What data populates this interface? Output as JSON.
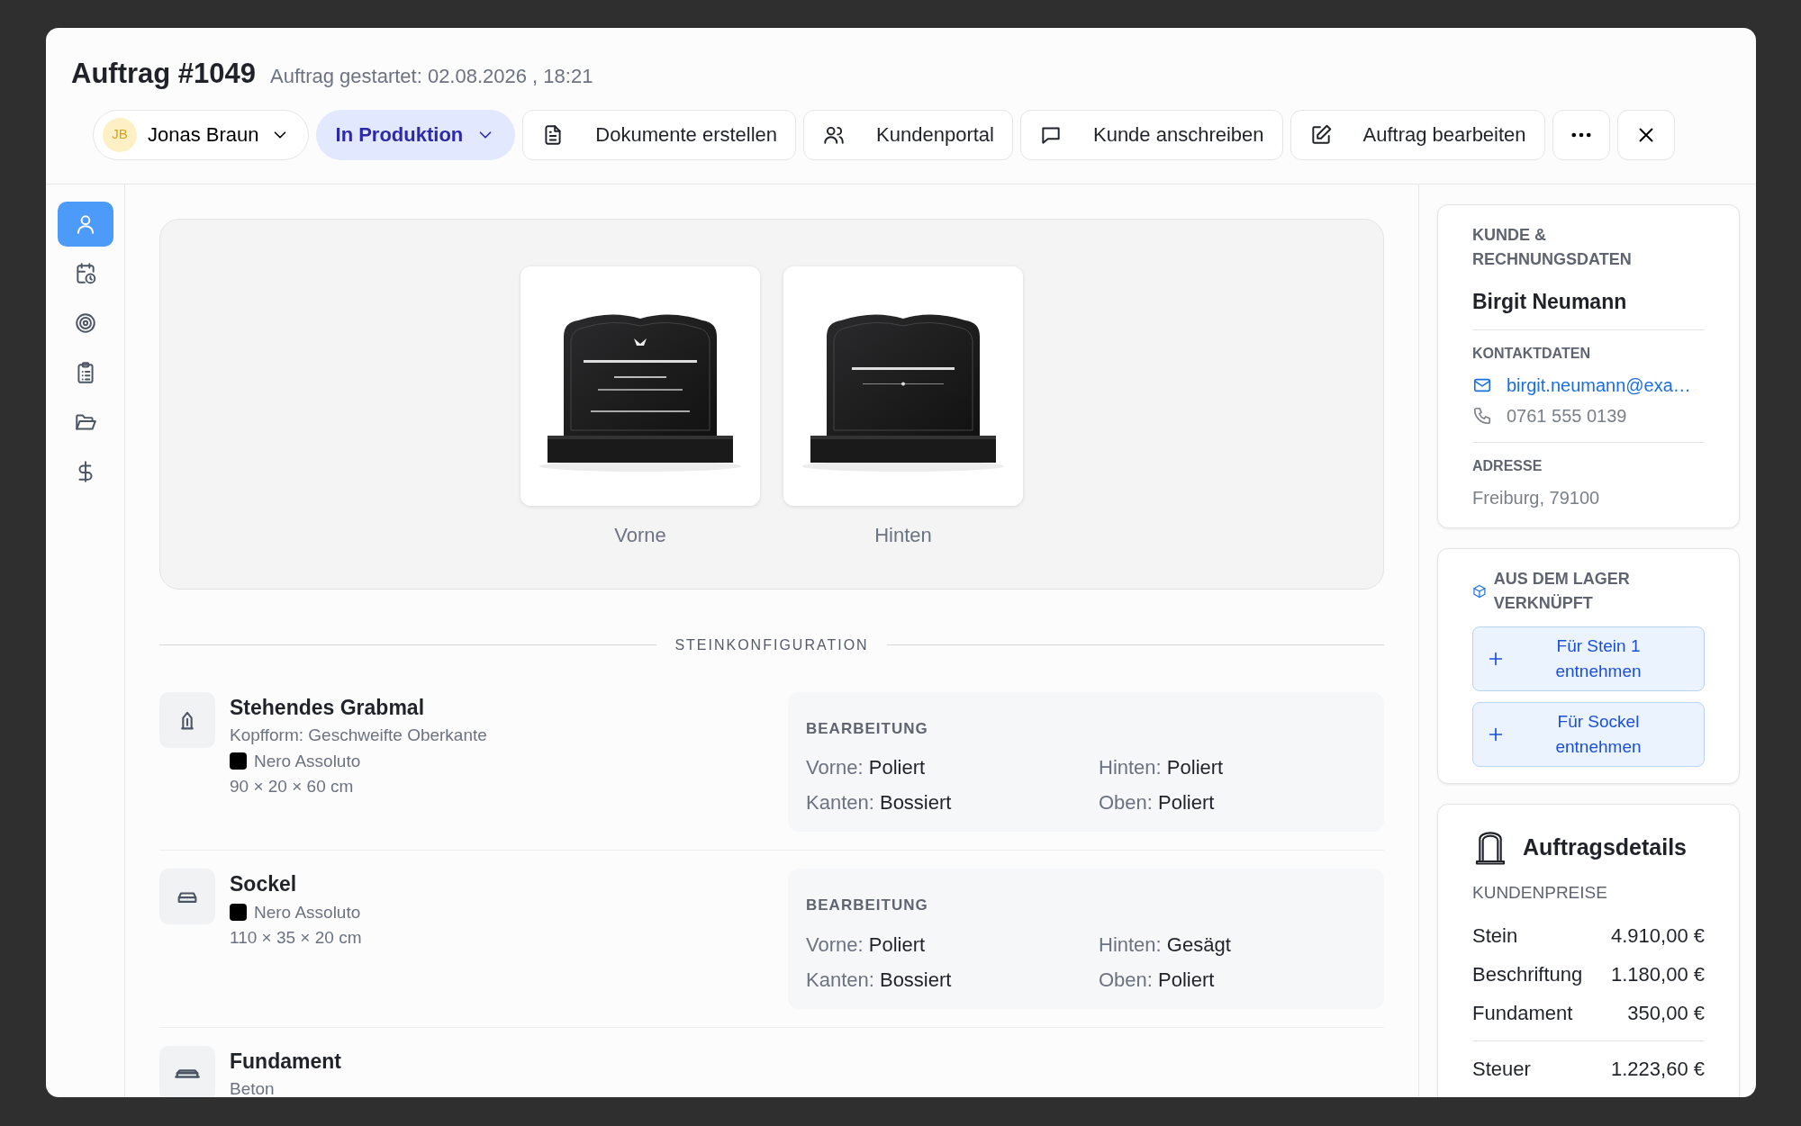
{
  "header": {
    "title": "Auftrag #1049",
    "started_label": "Auftrag gestartet:",
    "started_value": "02.08.2026 , 18:21"
  },
  "toolbar": {
    "assignee": {
      "initials": "JB",
      "name": "Jonas Braun"
    },
    "status": "In Produktion",
    "buttons": [
      {
        "kind": "document",
        "label": "Dokumente erstellen"
      },
      {
        "kind": "users",
        "label": "Kundenportal"
      },
      {
        "kind": "message",
        "label": "Kunde anschreiben"
      },
      {
        "kind": "edit",
        "label": "Auftrag bearbeiten"
      }
    ]
  },
  "nav": [
    {
      "kind": "person",
      "selected": true
    },
    {
      "kind": "calendar",
      "selected": false
    },
    {
      "kind": "target",
      "selected": false
    },
    {
      "kind": "clipboard",
      "selected": false
    },
    {
      "kind": "folder",
      "selected": false
    },
    {
      "kind": "dollar",
      "selected": false
    }
  ],
  "preview": {
    "images": [
      {
        "kind": "front",
        "caption": "Vorne"
      },
      {
        "kind": "back",
        "caption": "Hinten"
      }
    ]
  },
  "configuration": {
    "heading": "STEINKONFIGURATION",
    "items": [
      {
        "kind": "upright",
        "name": "Stehendes Grabmal",
        "details": [
          "Kopfform: Geschweifte Oberkante"
        ],
        "material": {
          "name": "Nero Assoluto",
          "color": "#000000"
        },
        "dimensions": "90 × 20 × 60 cm",
        "processing": {
          "title": "BEARBEITUNG",
          "entries": [
            {
              "label": "Vorne:",
              "value": "Poliert"
            },
            {
              "label": "Hinten:",
              "value": "Poliert"
            },
            {
              "label": "Kanten:",
              "value": "Bossiert"
            },
            {
              "label": "Oben:",
              "value": "Poliert"
            }
          ]
        }
      },
      {
        "kind": "base",
        "name": "Sockel",
        "material": {
          "name": "Nero Assoluto",
          "color": "#000000"
        },
        "dimensions": "110 × 35 × 20 cm",
        "processing": {
          "title": "BEARBEITUNG",
          "entries": [
            {
              "label": "Vorne:",
              "value": "Poliert"
            },
            {
              "label": "Hinten:",
              "value": "Gesägt"
            },
            {
              "label": "Kanten:",
              "value": "Bossiert"
            },
            {
              "label": "Oben:",
              "value": "Poliert"
            }
          ]
        }
      },
      {
        "kind": "foundation",
        "name": "Fundament",
        "details": [
          "Beton"
        ]
      }
    ]
  },
  "customer": {
    "heading": "KUNDE & RECHNUNGSDATEN",
    "name": "Birgit Neumann",
    "contact_heading": "KONTAKTDATEN",
    "email": "birgit.neumann@exa…",
    "phone": "0761 555 0139",
    "address_heading": "ADRESSE",
    "address": "Freiburg, 79100"
  },
  "stock": {
    "heading": "AUS DEM LAGER VERKNÜPFT",
    "buttons": [
      "Für Stein 1 entnehmen",
      "Für Sockel entnehmen"
    ]
  },
  "details": {
    "title": "Auftragsdetails",
    "subheading": "KUNDENPREISE",
    "prices": [
      {
        "label": "Stein",
        "amount": "4.910,00 €"
      },
      {
        "label": "Beschriftung",
        "amount": "1.180,00 €"
      },
      {
        "label": "Fundament",
        "amount": "350,00 €"
      }
    ],
    "totals": [
      {
        "label": "Steuer",
        "amount": "1.223,60 €"
      }
    ]
  }
}
